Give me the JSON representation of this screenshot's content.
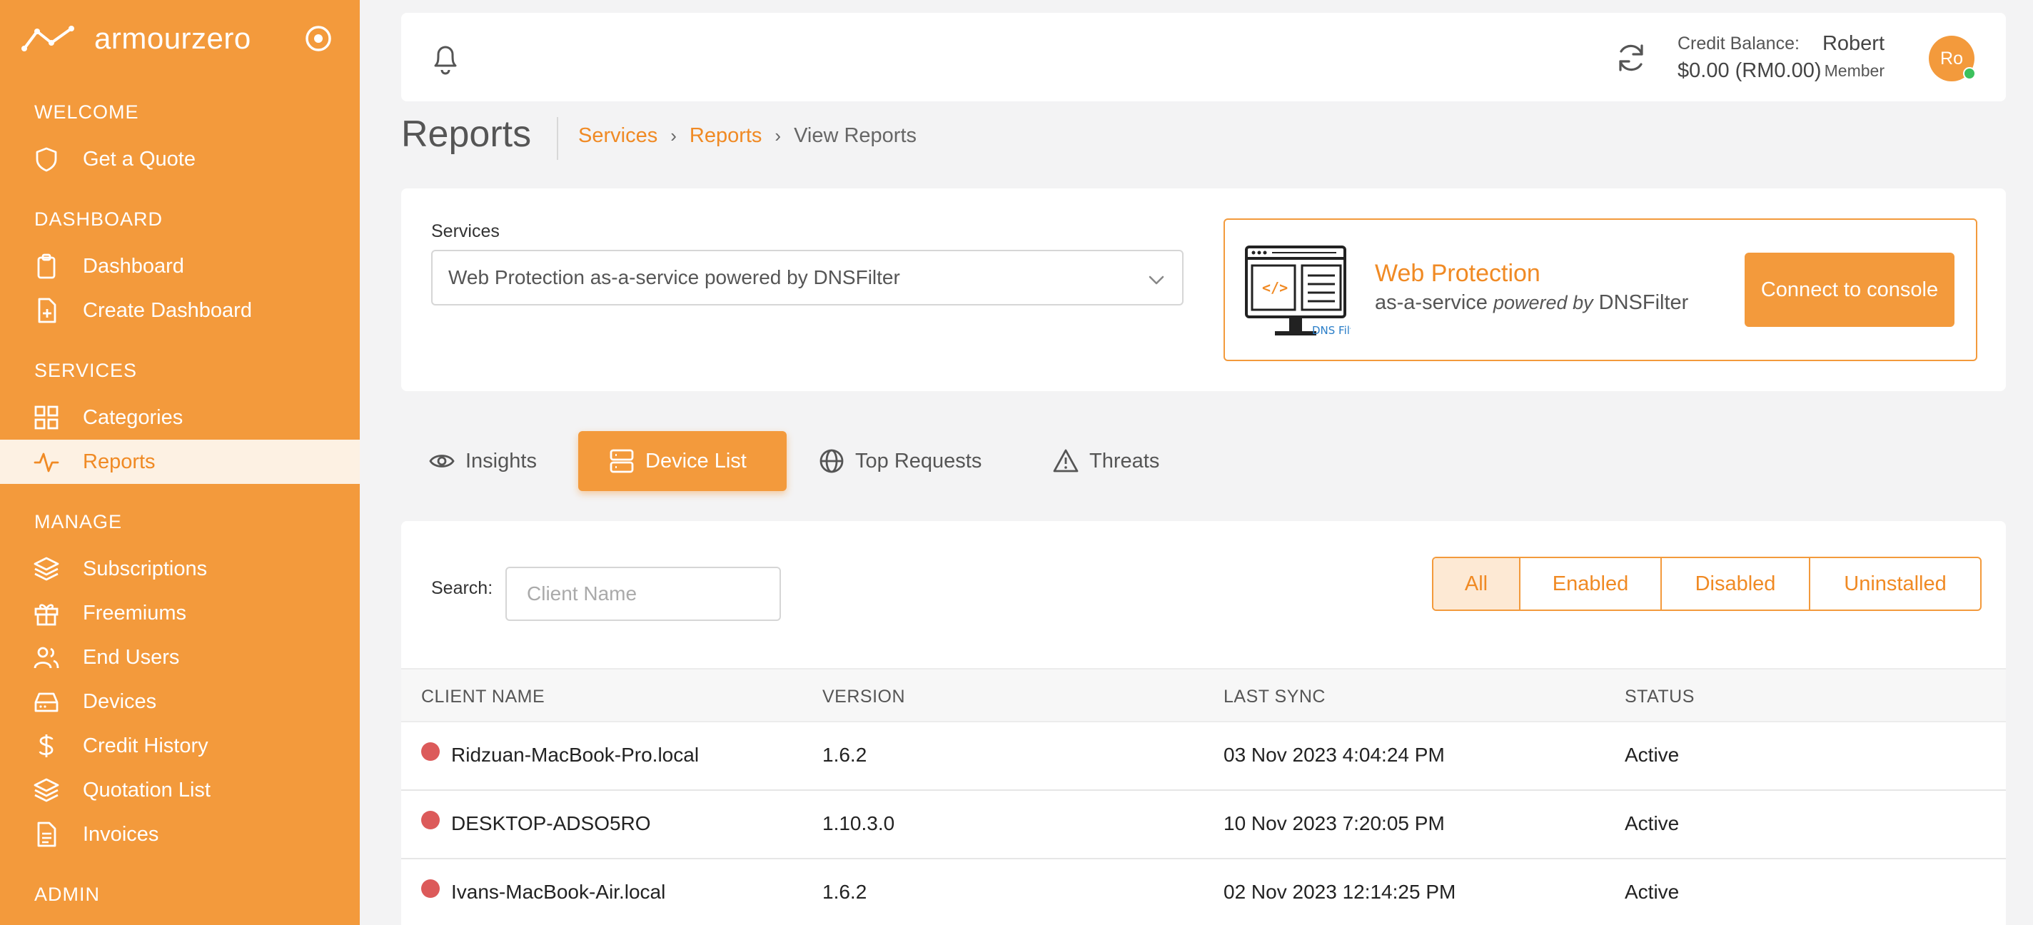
{
  "app": {
    "brand_name": "armourzero"
  },
  "sidebar": {
    "sections": [
      {
        "title": "WELCOME",
        "items": [
          {
            "label": "Get a Quote",
            "icon": "shield-icon"
          }
        ]
      },
      {
        "title": "DASHBOARD",
        "items": [
          {
            "label": "Dashboard",
            "icon": "clipboard-icon"
          },
          {
            "label": "Create Dashboard",
            "icon": "file-plus-icon"
          }
        ]
      },
      {
        "title": "SERVICES",
        "items": [
          {
            "label": "Categories",
            "icon": "grid-icon"
          },
          {
            "label": "Reports",
            "icon": "activity-icon",
            "active": true
          }
        ]
      },
      {
        "title": "MANAGE",
        "items": [
          {
            "label": "Subscriptions",
            "icon": "layers-icon"
          },
          {
            "label": "Freemiums",
            "icon": "gift-icon"
          },
          {
            "label": "End Users",
            "icon": "users-icon"
          },
          {
            "label": "Devices",
            "icon": "hard-drive-icon"
          },
          {
            "label": "Credit History",
            "icon": "dollar-icon"
          },
          {
            "label": "Quotation List",
            "icon": "layers-icon"
          },
          {
            "label": "Invoices",
            "icon": "file-text-icon"
          }
        ]
      },
      {
        "title": "ADMIN",
        "items": []
      }
    ]
  },
  "header": {
    "credit_label": "Credit Balance:",
    "credit_amount": "$0.00 (RM0.00)",
    "user_name": "Robert",
    "user_role": "Member",
    "avatar_initials": "Ro"
  },
  "page": {
    "title": "Reports",
    "breadcrumbs": [
      "Services",
      "Reports",
      "View Reports"
    ]
  },
  "services": {
    "label": "Services",
    "selected": "Web Protection as-a-service powered by DNSFilter",
    "promo_title": "Web Protection",
    "promo_sub_prefix": "as-a-service",
    "promo_sub_italic": "powered by",
    "promo_sub_suffix": "DNSFilter",
    "promo_art_label": "DNS Filter",
    "connect_button": "Connect to console"
  },
  "tabs": [
    {
      "label": "Insights",
      "icon": "eye-icon"
    },
    {
      "label": "Device List",
      "icon": "server-icon",
      "active": true
    },
    {
      "label": "Top Requests",
      "icon": "globe-icon"
    },
    {
      "label": "Threats",
      "icon": "alert-triangle-icon"
    }
  ],
  "device_list": {
    "search_label": "Search:",
    "search_placeholder": "Client Name",
    "filters": [
      {
        "label": "All",
        "active": true
      },
      {
        "label": "Enabled"
      },
      {
        "label": "Disabled"
      },
      {
        "label": "Uninstalled"
      }
    ],
    "columns": [
      "CLIENT NAME",
      "VERSION",
      "LAST SYNC",
      "STATUS"
    ],
    "rows": [
      {
        "client": "Ridzuan-MacBook-Pro.local",
        "version": "1.6.2",
        "last_sync": "03 Nov 2023 4:04:24 PM",
        "status": "Active"
      },
      {
        "client": "DESKTOP-ADSO5RO",
        "version": "1.10.3.0",
        "last_sync": "10 Nov 2023 7:20:05 PM",
        "status": "Active"
      },
      {
        "client": "Ivans-MacBook-Air.local",
        "version": "1.6.2",
        "last_sync": "02 Nov 2023 12:14:25 PM",
        "status": "Active"
      }
    ]
  },
  "colors": {
    "accent": "#f39a3c",
    "accent_text": "#f08a24",
    "status_dot": "#dc5a5a",
    "online": "#3cc15d"
  }
}
